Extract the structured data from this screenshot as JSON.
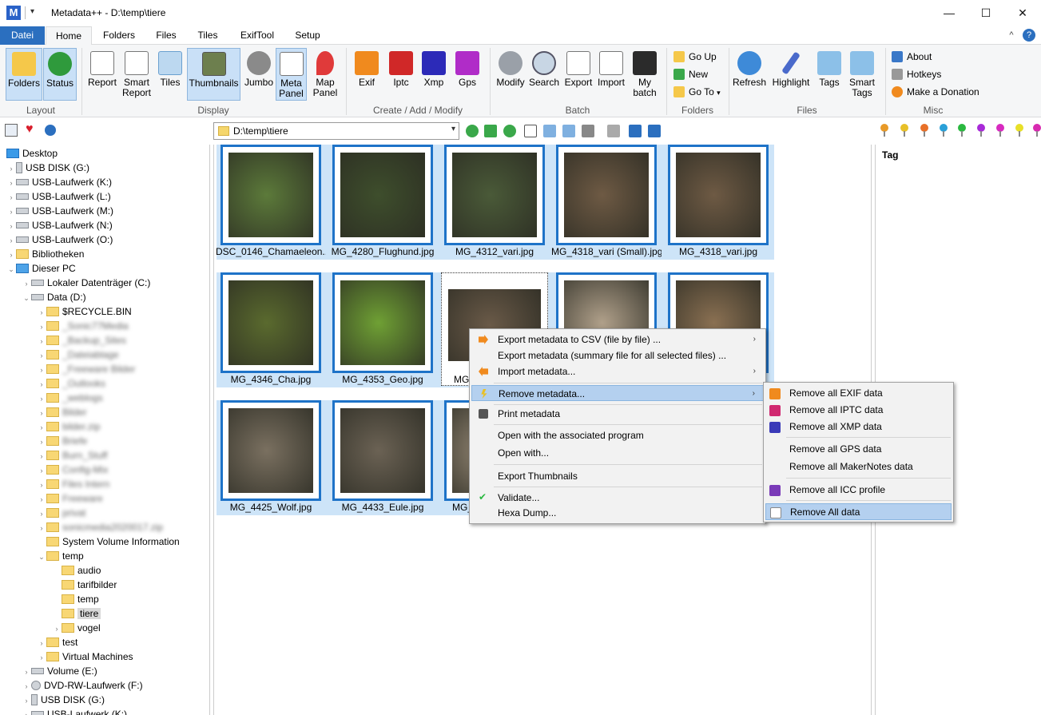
{
  "window": {
    "title": "Metadata++ - D:\\temp\\tiere",
    "minimize": "—",
    "maximize": "☐",
    "close": "✕",
    "app_icon": "M"
  },
  "tabs": {
    "file": "Datei",
    "items": [
      "Home",
      "Folders",
      "Files",
      "Tiles",
      "ExifTool",
      "Setup"
    ],
    "help_icon": "?",
    "collapse_icon": "^"
  },
  "ribbon": {
    "layout": {
      "folders": "Folders",
      "status": "Status",
      "group": "Layout"
    },
    "display": {
      "report": "Report",
      "smart_report_1": "Smart",
      "smart_report_2": "Report",
      "tiles": "Tiles",
      "thumbnails": "Thumbnails",
      "jumbo": "Jumbo",
      "meta_panel_1": "Meta",
      "meta_panel_2": "Panel",
      "map_panel_1": "Map",
      "map_panel_2": "Panel",
      "group": "Display"
    },
    "create": {
      "exif": "Exif",
      "iptc": "Iptc",
      "xmp": "Xmp",
      "gps": "Gps",
      "group": "Create / Add / Modify"
    },
    "batch": {
      "modify": "Modify",
      "search": "Search",
      "export": "Export",
      "import": "Import",
      "my_batch_1": "My",
      "my_batch_2": "batch",
      "group": "Batch"
    },
    "folders": {
      "go_up": "Go Up",
      "new": "New",
      "go_to": "Go To",
      "group": "Folders"
    },
    "files": {
      "refresh": "Refresh",
      "highlight": "Highlight",
      "tags": "Tags",
      "smart_tags_1": "Smart",
      "smart_tags_2": "Tags",
      "group": "Files"
    },
    "misc": {
      "about": "About",
      "hotkeys": "Hotkeys",
      "donation": "Make a Donation",
      "group": "Misc"
    }
  },
  "path": {
    "value": "D:\\temp\\tiere"
  },
  "tree": {
    "desktop": "Desktop",
    "usb_g": "USB DISK (G:)",
    "usb_k": "USB-Laufwerk (K:)",
    "usb_l": "USB-Laufwerk (L:)",
    "usb_m": "USB-Laufwerk (M:)",
    "usb_n": "USB-Laufwerk (N:)",
    "usb_o": "USB-Laufwerk (O:)",
    "libs": "Bibliotheken",
    "pc": "Dieser PC",
    "local_c": "Lokaler Datenträger (C:)",
    "data_d": "Data (D:)",
    "recycle": "$RECYCLE.BIN",
    "blur1": "_Sonic77Media",
    "blur2": "_Backup_Sites",
    "blur3": "_Dateiablage",
    "blur4": "_Freeware Bilder",
    "blur5": "_Outlooks",
    "blur6": "_weblogs",
    "blur7": "Bilder",
    "blur8": "bilder.zip",
    "blur9": "Briefe",
    "blur10": "Burn_Stuff",
    "blur11": "Config-Mix",
    "blur12": "Files Intern",
    "blur13": "Freeware",
    "blur14": "privat",
    "blur15": "sonicmedia2020017.zip",
    "svi": "System Volume Information",
    "temp": "temp",
    "audio": "audio",
    "tarif": "tarifbilder",
    "temp2": "temp",
    "tiere": "tiere",
    "vogel": "vogel",
    "test": "test",
    "vm": "Virtual Machines",
    "vol_e": "Volume (E:)",
    "dvd_f": "DVD-RW-Laufwerk (F:)",
    "usb_g2": "USB DISK (G:)",
    "usb_k2": "USB-Laufwerk (K:)"
  },
  "thumbs": [
    {
      "label": "DSC_0146_Chamaeleon...",
      "color": "#5c7a3a"
    },
    {
      "label": "MG_4280_Flughund.jpg",
      "color": "#3e4e2c"
    },
    {
      "label": "MG_4312_vari.jpg",
      "color": "#4a5a38"
    },
    {
      "label": "MG_4318_vari (Small).jpg",
      "color": "#6e5a44"
    },
    {
      "label": "MG_4318_vari.jpg",
      "color": "#6e5a44"
    },
    {
      "label": "MG_4346_Cha.jpg",
      "color": "#5a6a2e"
    },
    {
      "label": "MG_4353_Geo.jpg",
      "color": "#6fa034"
    },
    {
      "label": "MG_",
      "color": "#6a5a48"
    },
    {
      "label": "",
      "color": "#b0a08a"
    },
    {
      "label": "",
      "color": "#8a7052"
    },
    {
      "label": "MG_4425_Wolf.jpg",
      "color": "#7a7060"
    },
    {
      "label": "MG_4433_Eule.jpg",
      "color": "#6b6254"
    },
    {
      "label": "MG_",
      "color": "#9a8c78"
    }
  ],
  "tag_panel": {
    "header": "Tag"
  },
  "context_menu": {
    "export_csv": "Export metadata to CSV (file by file) ...",
    "export_summary": "Export metadata (summary file for all selected files) ...",
    "import": "Import metadata...",
    "remove": "Remove metadata...",
    "print": "Print metadata",
    "open_assoc": "Open with the associated program",
    "open_with": "Open with...",
    "export_thumbs": "Export Thumbnails",
    "validate": "Validate...",
    "hexa": "Hexa Dump..."
  },
  "submenu": {
    "exif": "Remove all EXIF data",
    "iptc": "Remove all IPTC data",
    "xmp": "Remove all XMP data",
    "gps": "Remove all GPS data",
    "makernotes": "Remove all MakerNotes data",
    "icc": "Remove all ICC profile",
    "all": "Remove All data"
  }
}
